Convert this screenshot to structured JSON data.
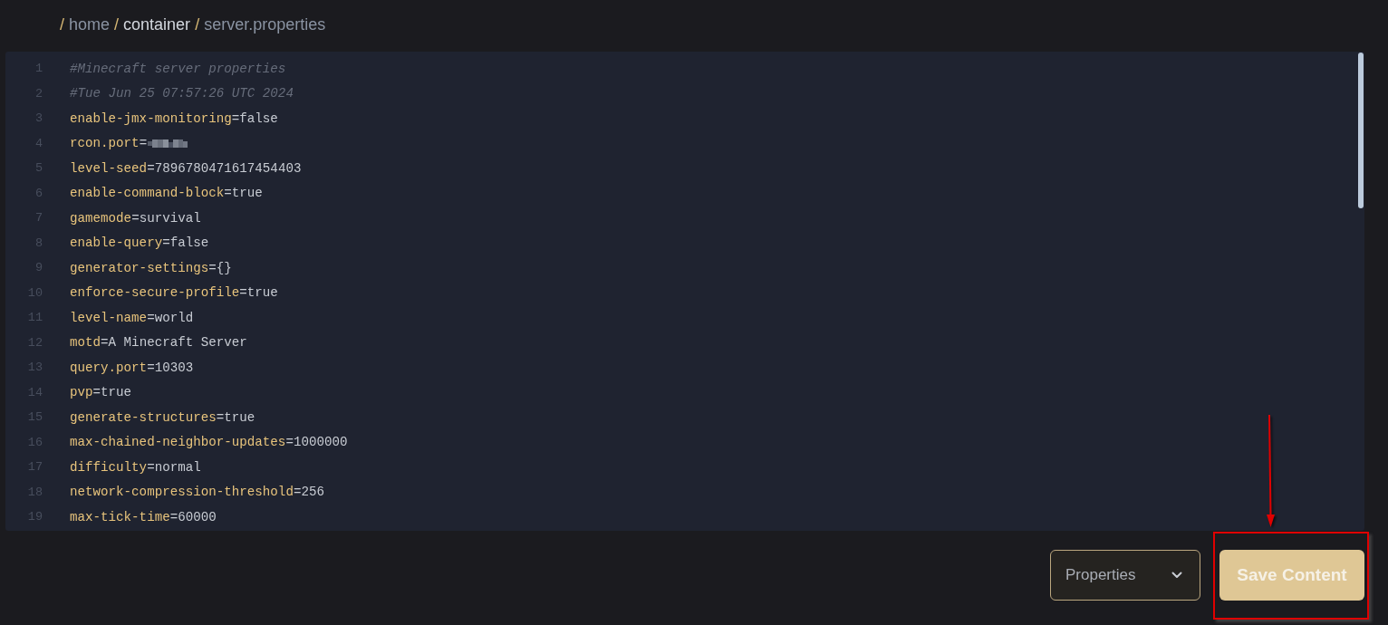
{
  "breadcrumb": [
    {
      "separator": "/",
      "label": "home",
      "highlighted": false
    },
    {
      "separator": "/",
      "label": "container",
      "highlighted": true
    },
    {
      "separator": "/",
      "label": "server.properties",
      "highlighted": false
    }
  ],
  "editor": {
    "lines": [
      {
        "number": "1",
        "kind": "comment",
        "text": "#Minecraft server properties"
      },
      {
        "number": "2",
        "kind": "comment",
        "text": "#Tue Jun 25 07:57:26 UTC 2024"
      },
      {
        "number": "3",
        "kind": "property",
        "key": "enable-jmx-monitoring",
        "separator": "=",
        "value": "false"
      },
      {
        "number": "4",
        "kind": "masked",
        "key": "rcon.port",
        "separator": "="
      },
      {
        "number": "5",
        "kind": "property",
        "key": "level-seed",
        "separator": "=",
        "value": "7896780471617454403"
      },
      {
        "number": "6",
        "kind": "property",
        "key": "enable-command-block",
        "separator": "=",
        "value": "true"
      },
      {
        "number": "7",
        "kind": "property",
        "key": "gamemode",
        "separator": "=",
        "value": "survival"
      },
      {
        "number": "8",
        "kind": "property",
        "key": "enable-query",
        "separator": "=",
        "value": "false"
      },
      {
        "number": "9",
        "kind": "property",
        "key": "generator-settings",
        "separator": "=",
        "value": "{}"
      },
      {
        "number": "10",
        "kind": "property",
        "key": "enforce-secure-profile",
        "separator": "=",
        "value": "true"
      },
      {
        "number": "11",
        "kind": "property",
        "key": "level-name",
        "separator": "=",
        "value": "world"
      },
      {
        "number": "12",
        "kind": "property",
        "key": "motd",
        "separator": "=",
        "value": "A Minecraft Server"
      },
      {
        "number": "13",
        "kind": "property",
        "key": "query.port",
        "separator": "=",
        "value": "10303"
      },
      {
        "number": "14",
        "kind": "property",
        "key": "pvp",
        "separator": "=",
        "value": "true"
      },
      {
        "number": "15",
        "kind": "property",
        "key": "generate-structures",
        "separator": "=",
        "value": "true"
      },
      {
        "number": "16",
        "kind": "property",
        "key": "max-chained-neighbor-updates",
        "separator": "=",
        "value": "1000000"
      },
      {
        "number": "17",
        "kind": "property",
        "key": "difficulty",
        "separator": "=",
        "value": "normal"
      },
      {
        "number": "18",
        "kind": "property",
        "key": "network-compression-threshold",
        "separator": "=",
        "value": "256"
      },
      {
        "number": "19",
        "kind": "property",
        "key": "max-tick-time",
        "separator": "=",
        "value": "60000"
      }
    ]
  },
  "footer": {
    "file_type": {
      "value": "Properties"
    },
    "save_button": {
      "label": "Save Content"
    }
  },
  "annotations": {
    "arrow": true,
    "highlight_frame": true
  }
}
